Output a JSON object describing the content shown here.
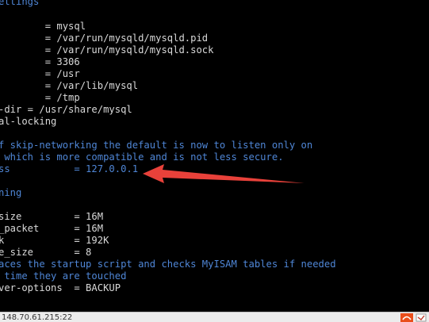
{
  "terminal": {
    "lines": [
      {
        "text": "ettings",
        "kind": "comment"
      },
      {
        "text": "",
        "kind": "normal"
      },
      {
        "text": "        = mysql",
        "kind": "normal"
      },
      {
        "text": "        = /var/run/mysqld/mysqld.pid",
        "kind": "normal"
      },
      {
        "text": "        = /var/run/mysqld/mysqld.sock",
        "kind": "normal"
      },
      {
        "text": "        = 3306",
        "kind": "normal"
      },
      {
        "text": "        = /usr",
        "kind": "normal"
      },
      {
        "text": "        = /var/lib/mysql",
        "kind": "normal"
      },
      {
        "text": "        = /tmp",
        "kind": "normal"
      },
      {
        "text": "-dir = /usr/share/mysql",
        "kind": "normal"
      },
      {
        "text": "al-locking",
        "kind": "normal"
      },
      {
        "text": "",
        "kind": "normal"
      },
      {
        "text": "f skip-networking the default is now to listen only on",
        "kind": "comment"
      },
      {
        "text": " which is more compatible and is not less secure.",
        "kind": "comment"
      },
      {
        "text": "ss           = 127.0.0.1",
        "kind": "comment"
      },
      {
        "text": "",
        "kind": "normal"
      },
      {
        "text": "ning",
        "kind": "comment"
      },
      {
        "text": "",
        "kind": "normal"
      },
      {
        "text": "size         = 16M",
        "kind": "normal"
      },
      {
        "text": "_packet      = 16M",
        "kind": "normal"
      },
      {
        "text": "k            = 192K",
        "kind": "normal"
      },
      {
        "text": "e_size       = 8",
        "kind": "normal"
      },
      {
        "text": "aces the startup script and checks MyISAM tables if needed",
        "kind": "comment"
      },
      {
        "text": " time they are touched",
        "kind": "comment"
      },
      {
        "text": "ver-options  = BACKUP",
        "kind": "normal"
      }
    ],
    "colors": {
      "background": "#000000",
      "text": "#d9d9d9",
      "comment": "#4f86d6",
      "annotation_arrow": "#e8413a"
    }
  },
  "statusbar": {
    "address": "148.70.61.215:22",
    "icons": [
      "app-logo-icon",
      "tray-icon"
    ]
  }
}
